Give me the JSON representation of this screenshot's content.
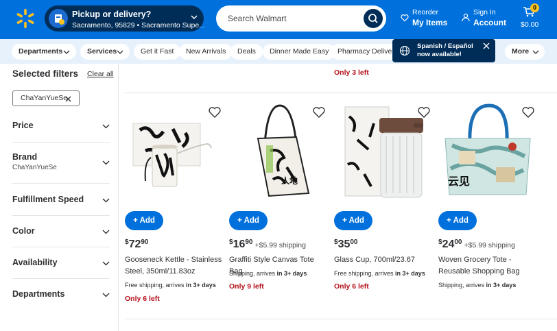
{
  "header": {
    "pickup_title": "Pickup or delivery?",
    "pickup_location": "Sacramento, 95829 • Sacramento Supe...",
    "search_placeholder": "Search Walmart",
    "reorder_small": "Reorder",
    "reorder_big": "My Items",
    "signin_small": "Sign In",
    "signin_big": "Account",
    "cart_count": "0",
    "cart_total": "$0.00"
  },
  "categories": [
    {
      "label": "Departments",
      "chevron": true,
      "bold": true
    },
    {
      "label": "Services",
      "chevron": true,
      "bold": true
    },
    {
      "label": "Get it Fast"
    },
    {
      "label": "New Arrivals"
    },
    {
      "label": "Deals"
    },
    {
      "label": "Dinner Made Easy"
    },
    {
      "label": "Pharmacy Delivery"
    },
    {
      "label": "More",
      "chevron": true,
      "bold": true
    }
  ],
  "tooltip": {
    "line1": "Spanish / Español",
    "line2": "now available!"
  },
  "sidebar": {
    "title": "Selected filters",
    "clear": "Clear all",
    "chip": "ChaYanYueSe",
    "facets": [
      {
        "title": "Price",
        "sub": ""
      },
      {
        "title": "Brand",
        "sub": "ChaYanYueSe"
      },
      {
        "title": "Fulfillment Speed",
        "sub": ""
      },
      {
        "title": "Color",
        "sub": ""
      },
      {
        "title": "Availability",
        "sub": ""
      },
      {
        "title": "Departments",
        "sub": ""
      }
    ]
  },
  "top_stock": "Only 3 left",
  "products": [
    {
      "add": "Add",
      "dollars": "72",
      "cents": "90",
      "ship_price": "",
      "name": "Gooseneck Kettle - Stainless Steel, 350ml/11.83oz",
      "ship_text": "Free shipping, arrives ",
      "ship_bold": "in 3+ days",
      "stock": "Only 6 left"
    },
    {
      "add": "Add",
      "dollars": "16",
      "cents": "90",
      "ship_price": "+$5.99 shipping",
      "name": "Graffiti Style Canvas Tote Bag",
      "ship_text": "Shipping, arrives ",
      "ship_bold": "in 3+ days",
      "stock": "Only 9 left"
    },
    {
      "add": "Add",
      "dollars": "35",
      "cents": "00",
      "ship_price": "",
      "name": "Glass Cup, 700ml/23.67",
      "ship_text": "Free shipping, arrives ",
      "ship_bold": "in 3+ days",
      "stock": "Only 6 left"
    },
    {
      "add": "Add",
      "dollars": "24",
      "cents": "00",
      "ship_price": "+$5.99 shipping",
      "name": "Woven Grocery Tote - Reusable Shopping Bag",
      "ship_text": "Shipping, arrives ",
      "ship_bold": "in 3+ days",
      "stock": ""
    }
  ],
  "icons": {
    "logo": "walmart-spark-icon",
    "search": "search-icon",
    "heart": "heart-icon",
    "cart": "cart-icon",
    "globe": "globe-icon"
  },
  "colors": {
    "brand_blue": "#0071dc",
    "navy": "#002d58",
    "yellow": "#ffc220",
    "red": "#b5121b"
  }
}
